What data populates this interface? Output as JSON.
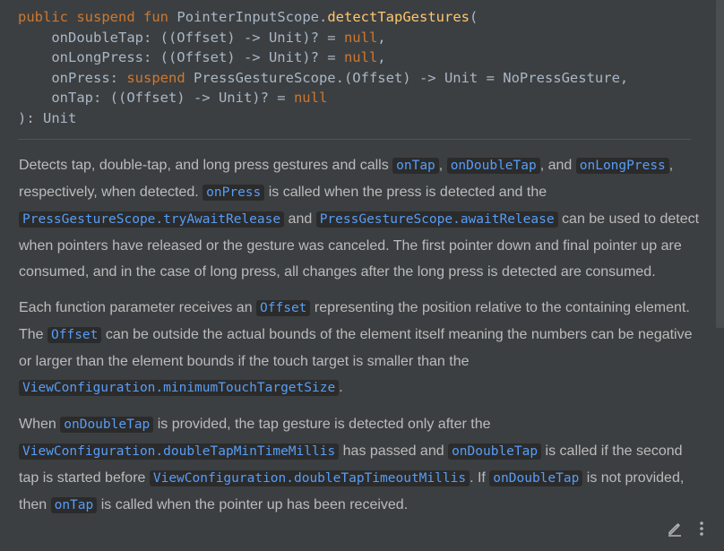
{
  "signature": {
    "kw_public": "public",
    "kw_suspend": "suspend",
    "kw_fun": "fun",
    "receiver": "PointerInputScope.",
    "fn_name": "detectTapGestures",
    "open_paren": "(",
    "p1_name": "    onDoubleTap: ((Offset) -> Unit)? = ",
    "p1_null": "null",
    "p1_comma": ",",
    "p2_name": "    onLongPress: ((Offset) -> Unit)? = ",
    "p2_null": "null",
    "p2_comma": ",",
    "p3_name": "    onPress: ",
    "p3_kw": "suspend",
    "p3_rest": " PressGestureScope.(Offset) -> Unit = NoPressGesture,",
    "p4_name": "    onTap: ((Offset) -> Unit)? = ",
    "p4_null": "null",
    "close": "): Unit"
  },
  "doc": {
    "p1": {
      "t1": "Detects tap, double-tap, and long press gestures and calls ",
      "c1": "onTap",
      "t2": ", ",
      "c2": "onDoubleTap",
      "t3": ", and ",
      "c3": "onLongPress",
      "t4": ", respectively, when detected. ",
      "c4": "onPress",
      "t5": " is called when the press is detected and the ",
      "c5": "PressGestureScope.tryAwaitRelease",
      "t6": " and ",
      "c6": "PressGestureScope.awaitRelease",
      "t7": " can be used to detect when pointers have released or the gesture was canceled. The first pointer down and final pointer up are consumed, and in the case of long press, all changes after the long press is detected are consumed."
    },
    "p2": {
      "t1": "Each function parameter receives an ",
      "c1": "Offset",
      "t2": " representing the position relative to the containing element. The ",
      "c2": "Offset",
      "t3": " can be outside the actual bounds of the element itself meaning the numbers can be negative or larger than the element bounds if the touch target is smaller than the ",
      "c3": "ViewConfiguration.minimumTouchTargetSize",
      "t4": "."
    },
    "p3": {
      "t1": "When ",
      "c1": "onDoubleTap",
      "t2": " is provided, the tap gesture is detected only after the ",
      "c2": "ViewConfiguration.doubleTapMinTimeMillis",
      "t3": " has passed and ",
      "c3": "onDoubleTap",
      "t4": " is called if the second tap is started before ",
      "c4": "ViewConfiguration.doubleTapTimeoutMillis",
      "t5": ". If ",
      "c5": "onDoubleTap",
      "t6": " is not provided, then ",
      "c6": "onTap",
      "t7": " is called when the pointer up has been received."
    }
  },
  "toolbar": {
    "edit_icon": "pencil-icon",
    "more_icon": "more-vertical-icon"
  },
  "colors": {
    "background": "#3c3f41",
    "keyword": "#cc7832",
    "function": "#ffc66d",
    "code_link": "#589df6",
    "text": "#bbbbbb"
  }
}
